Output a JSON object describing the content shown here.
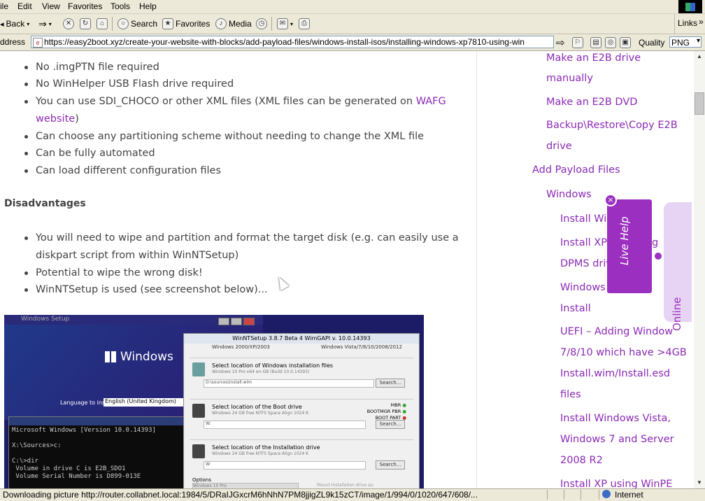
{
  "menu": [
    "ile",
    "Edit",
    "View",
    "Favorites",
    "Tools",
    "Help"
  ],
  "toolbar": {
    "back": "Back",
    "search": "Search",
    "favorites": "Favorites",
    "media": "Media",
    "links": "Links"
  },
  "address": {
    "label": "ddress",
    "url": "https://easy2boot.xyz/create-your-website-with-blocks/add-payload-files/windows-install-isos/installing-windows-xp7810-using-win",
    "quality_label": "Quality",
    "quality_value": "PNG"
  },
  "content": {
    "advantages": [
      "No .imgPTN file required",
      "No WinHelper USB Flash drive required",
      "You can use SDI_CHOCO or other XML files (XML files can be generated on",
      "Can choose any partitioning scheme without needing to change the XML file",
      "Can be fully automated",
      "Can load different  configuration files"
    ],
    "wafg_link_1": "WAFG",
    "wafg_link_2": "website",
    "wafg_close": ")",
    "disadvantages_heading": "Disadvantages",
    "disadvantages": [
      "You will need to wipe and partition and format the target disk (e.g. can easily use a",
      "diskpart script from within WinNTSetup)",
      "Potential to wipe the wrong disk!",
      "WinNTSetup is used (see screenshot below)..."
    ]
  },
  "screenshot": {
    "w10_title": "Windows Setup",
    "windows_text": "Windows",
    "lang_label": "Language to install:",
    "lang_value": "English (United Kingdom)",
    "cmd_lines": "Microsoft Windows [Version 10.0.14393]\n\nX:\\Sources>c:\n\nC:\\>dir\n Volume in drive C is E2B_SDO1\n Volume Serial Number is D899-013E",
    "winnt_title": "WinNTSetup 3.8.7 Beta 4        WimGAPI v. 10.0.14393",
    "tab1": "Windows 2000/XP/2003",
    "tab2": "Windows Vista/7/8/10/2008/2012",
    "sec1_h": "Select location of Windows installation files",
    "sec1_s": "Windows 10 Pro x64 en-GB (Build 10.0.14393)",
    "sec1_f": "D:\\sources\\install.wim",
    "sec2_h": "Select location of the Boot drive",
    "sec2_s": "Windows 24 GB free NTFS Space Align 1024 K",
    "sec2_f": "W:",
    "sec3_h": "Select location of the Installation drive",
    "sec3_s": "Windows 24 GB free NTFS Space Align 1024 K",
    "sec3_f": "W:",
    "mbr": "MBR",
    "bootmgr": "BOOTMGR PBR",
    "bootpart": "BOOT PART",
    "search_btn": "Search...",
    "options": "Options",
    "edition": "Windows 10 Pro",
    "mount": "Mount Installation drive as:"
  },
  "sidebar": [
    "Make an E2B drive",
    "manually",
    "Make an E2B DVD",
    "Backup\\Restore\\Copy E2B",
    "drive",
    "Add Payload Files",
    "Windows",
    "Install Wi",
    "Install XP",
    "DPMS driv",
    "Windows",
    "Install",
    "UEFI – Adding Window",
    "7/8/10 which have >4GB",
    "Install.wim/Install.esd",
    "files",
    "Install Windows Vista,",
    "Windows 7 and Server",
    "2008 R2",
    "Install XP using WinPE",
    "g"
  ],
  "widgets": {
    "live_help": "Live Help",
    "online": "Online",
    "close": "×"
  },
  "status": {
    "text": "Downloading picture http://router.collabnet.local:1984/5/DRaIJGxcrM6hNhN7PM8jjigZL9k15zCT/image/1/994/0/1020/647/608/...",
    "zone": "Internet"
  },
  "colors": {
    "link": "#8b2ab5",
    "live_help_bg": "#9b2fc0",
    "online_bg": "#e7d3f3"
  }
}
